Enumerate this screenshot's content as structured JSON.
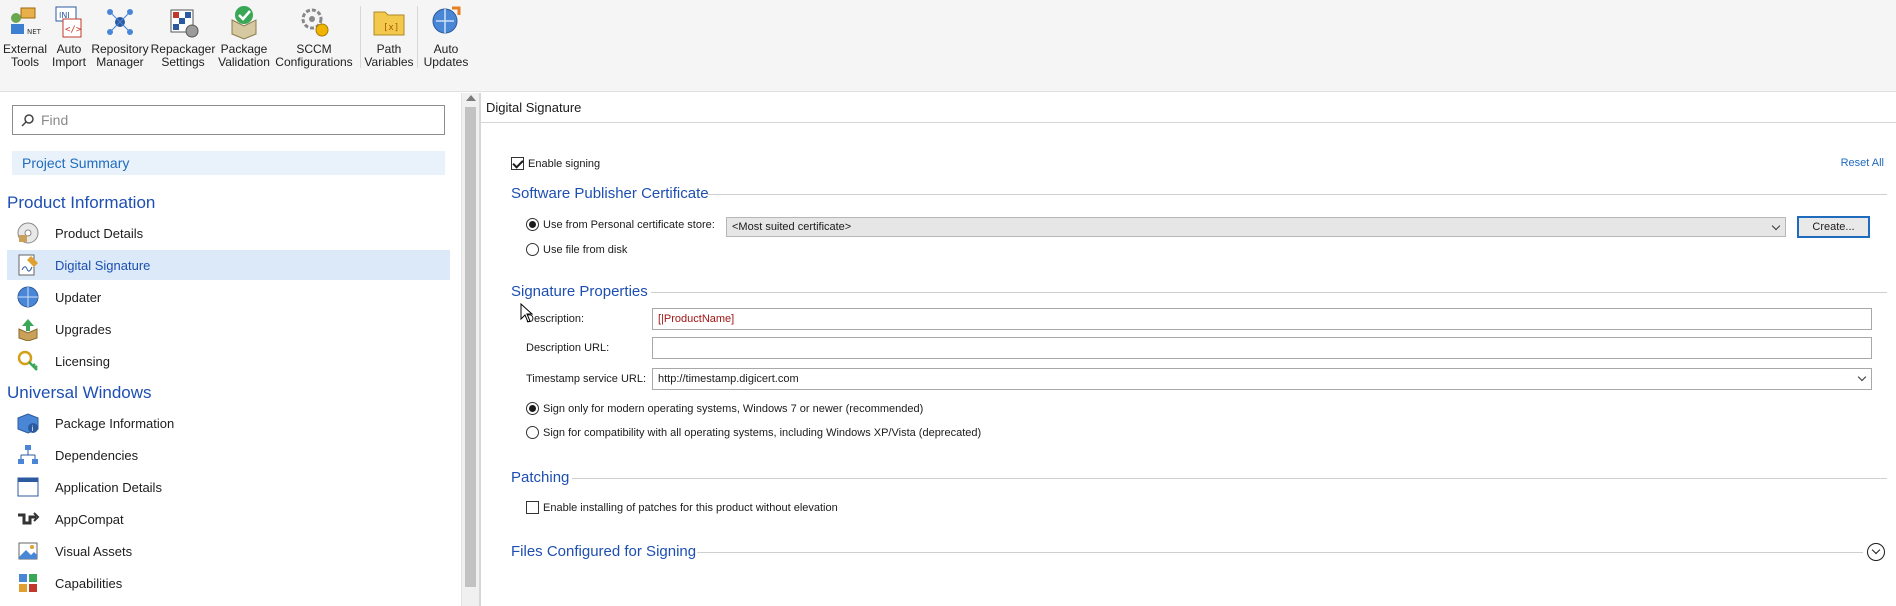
{
  "ribbon": {
    "buttons": [
      {
        "label": "External\nTools",
        "icon": "external-tools-icon"
      },
      {
        "label": "Auto\nImport",
        "icon": "auto-import-icon"
      },
      {
        "label": "Repository\nManager",
        "icon": "repository-manager-icon"
      },
      {
        "label": "Repackager\nSettings",
        "icon": "repackager-settings-icon"
      },
      {
        "label": "Package\nValidation",
        "icon": "package-validation-icon"
      },
      {
        "label": "SCCM\nConfigurations",
        "icon": "sccm-configurations-icon"
      },
      {
        "label": "Path\nVariables",
        "icon": "path-variables-icon"
      },
      {
        "label": "Auto\nUpdates",
        "icon": "auto-updates-icon"
      }
    ]
  },
  "sidebar": {
    "find_placeholder": "Find",
    "project_summary": "Project Summary",
    "section_product": "Product Information",
    "section_uwp": "Universal Windows",
    "product_items": [
      {
        "label": "Product Details",
        "icon": "product-details-icon"
      },
      {
        "label": "Digital Signature",
        "icon": "digital-signature-icon",
        "selected": true
      },
      {
        "label": "Updater",
        "icon": "updater-icon"
      },
      {
        "label": "Upgrades",
        "icon": "upgrades-icon"
      },
      {
        "label": "Licensing",
        "icon": "licensing-icon"
      }
    ],
    "uwp_items": [
      {
        "label": "Package Information",
        "icon": "package-information-icon"
      },
      {
        "label": "Dependencies",
        "icon": "dependencies-icon"
      },
      {
        "label": "Application Details",
        "icon": "application-details-icon"
      },
      {
        "label": "AppCompat",
        "icon": "appcompat-icon"
      },
      {
        "label": "Visual Assets",
        "icon": "visual-assets-icon"
      },
      {
        "label": "Capabilities",
        "icon": "capabilities-icon"
      }
    ]
  },
  "main": {
    "title": "Digital Signature",
    "enable_signing": "Enable signing",
    "enable_signing_checked": true,
    "reset_all": "Reset All",
    "certificate": {
      "heading": "Software Publisher Certificate",
      "use_store": "Use from Personal certificate store:",
      "store_selected": true,
      "store_value": "<Most suited certificate>",
      "create_button": "Create...",
      "use_file": "Use file from disk"
    },
    "signature": {
      "heading": "Signature Properties",
      "description_label": "Description:",
      "description_value": "[|ProductName]",
      "description_url_label": "Description URL:",
      "description_url_value": "",
      "timestamp_label": "Timestamp service URL:",
      "timestamp_value": "http://timestamp.digicert.com",
      "sign_modern": "Sign only for modern operating systems, Windows 7 or newer (recommended)",
      "sign_modern_selected": true,
      "sign_compat": "Sign for compatibility with all operating systems, including Windows XP/Vista (deprecated)"
    },
    "patching": {
      "heading": "Patching",
      "enable_patches": "Enable installing of patches for this product without elevation",
      "enable_patches_checked": false
    },
    "files": {
      "heading": "Files Configured for Signing"
    }
  },
  "colors": {
    "accent": "#1d4fb2",
    "link": "#1f6bbd",
    "selection": "#dbe9f8",
    "value_red": "#a31515"
  }
}
